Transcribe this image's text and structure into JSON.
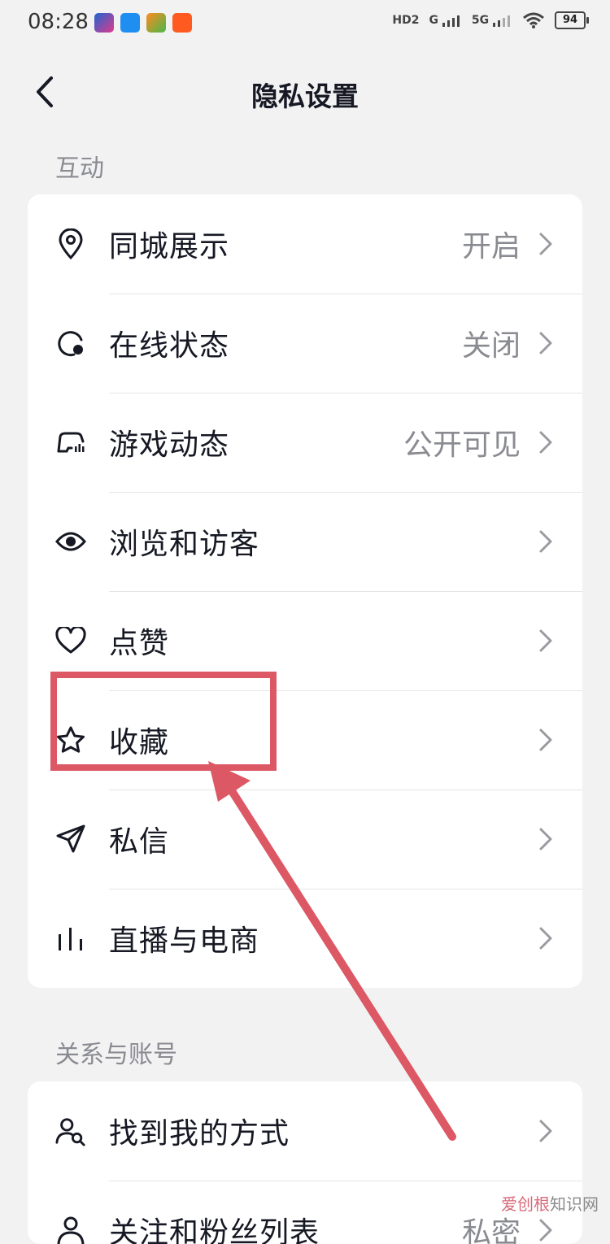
{
  "status_bar": {
    "time": "08:28",
    "hd_label": "HD2",
    "g_label": "G",
    "fiveg_label": "5G",
    "battery": "94"
  },
  "nav": {
    "title": "隐私设置"
  },
  "sections": {
    "interaction": {
      "header": "互动",
      "items": [
        {
          "label": "同城展示",
          "value": "开启",
          "icon": "location-pin-icon"
        },
        {
          "label": "在线状态",
          "value": "关闭",
          "icon": "online-status-icon"
        },
        {
          "label": "游戏动态",
          "value": "公开可见",
          "icon": "gamepad-icon"
        },
        {
          "label": "浏览和访客",
          "value": "",
          "icon": "eye-icon"
        },
        {
          "label": "点赞",
          "value": "",
          "icon": "heart-icon"
        },
        {
          "label": "收藏",
          "value": "",
          "icon": "star-icon"
        },
        {
          "label": "私信",
          "value": "",
          "icon": "send-icon"
        },
        {
          "label": "直播与电商",
          "value": "",
          "icon": "bar-chart-icon"
        }
      ]
    },
    "relationship": {
      "header": "关系与账号",
      "items": [
        {
          "label": "找到我的方式",
          "value": "",
          "icon": "find-user-icon"
        },
        {
          "label": "关注和粉丝列表",
          "value": "私密",
          "icon": "user-icon"
        }
      ]
    }
  },
  "watermark": {
    "accent": "爱创根",
    "rest": "知识网"
  },
  "colors": {
    "annotation": "#dc5864",
    "background": "#f2f2f3",
    "card": "#ffffff"
  }
}
